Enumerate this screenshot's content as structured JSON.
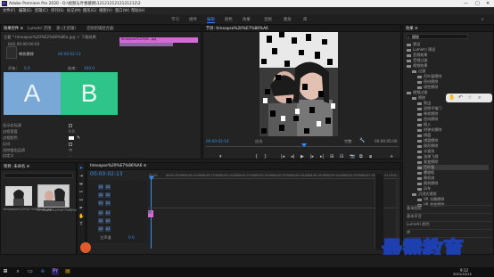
{
  "app": {
    "title": "Adobe Premiere Pro 2020 - D:\\视频与叶春葵网\\1212121212121212\\2",
    "window_controls": [
      "—",
      "□",
      "✕"
    ]
  },
  "menu": [
    "文件(F)",
    "编辑(E)",
    "剪辑(C)",
    "序列(S)",
    "标记(M)",
    "图形(G)",
    "视图(V)",
    "窗口(W)",
    "帮助(H)"
  ],
  "workspaces": [
    {
      "label": "学习",
      "active": false
    },
    {
      "label": "组件",
      "active": false
    },
    {
      "label": "编辑",
      "active": true
    },
    {
      "label": "颜色",
      "active": false
    },
    {
      "label": "效果",
      "active": false
    },
    {
      "label": "音频",
      "active": false
    },
    {
      "label": "图形",
      "active": false
    },
    {
      "label": "库",
      "active": false
    }
  ],
  "effect_controls": {
    "tabs": [
      "效果控件 ≡",
      "Lumetri 范围",
      "源:(无剪辑)",
      "音频剪辑混合器:"
    ],
    "source": "主要 * timeapse%20%E2%80%86a.jpg ＞ 下载效果",
    "sub": "时间 00:00:00:00",
    "fx_name": "带状擦除",
    "letters": [
      "A",
      "B"
    ],
    "start_label": "开始：",
    "start_val": "0.0",
    "end_label": "结束：",
    "end_val": "100.0",
    "rows": [
      {
        "label": "显示实际源",
        "type": "check"
      },
      {
        "label": "边框宽度",
        "type": "value",
        "value": "0.0"
      },
      {
        "label": "边框颜色",
        "type": "color"
      },
      {
        "label": "反向",
        "type": "check"
      },
      {
        "label": "消除锯齿品质",
        "type": "value",
        "value": "中"
      },
      {
        "label": "自定义",
        "type": "text",
        "value": "..."
      }
    ],
    "timecode": "00:00:02:13",
    "clip_label": "timeapse%20%6...jpg"
  },
  "program": {
    "tab": "节目: timeapse%20%E7%86%A6",
    "timecode_left": "00:00:02:14",
    "fit": "适合",
    "quality": "完整",
    "timecode_right": "00:00:05:00"
  },
  "transport": [
    "▾",
    "{",
    "}",
    "|◂",
    "◂|",
    "▶",
    "|▸",
    "▸|",
    "⊞",
    "⊟",
    "📷",
    "⧉",
    "⧈",
    "+"
  ],
  "project": {
    "tab": "项目: 未命名 ≡",
    "items": [
      {
        "name": "timeapse%20%E7%86%A6.jpg",
        "dur": "5:00"
      },
      {
        "name": "timeapse%20%E7%86%A6.jpg",
        "dur": "5:00"
      }
    ]
  },
  "timeline": {
    "tab": "timeapse%20%E7%86%A6 ≡",
    "timecode": "00:00:02:13",
    "ruler": [
      "00:00",
      "00:00:05:00",
      "00:00:10:00",
      "00:00:15:00",
      "00:00:20:00",
      "00:00:25:00",
      "00:00:30:00",
      "00:00:35:00",
      "00:00:40:00",
      "00:00:45:00",
      "00:00:50:00",
      "00:00:55:00",
      "00:01:00:00",
      "00:01:05:00"
    ],
    "tracks": [
      "V3",
      "V2",
      "V1",
      "A1",
      "A2",
      "A3"
    ],
    "master": "主声道",
    "master_val": "0.0"
  },
  "effects": {
    "tab": "效果 ≡",
    "search": "擦除",
    "tree": [
      {
        "label": "预设",
        "level": 0
      },
      {
        "label": "Lumetri 预设",
        "level": 0
      },
      {
        "label": "音频效果",
        "level": 0
      },
      {
        "label": "音频过渡",
        "level": 0
      },
      {
        "label": "视频效果",
        "level": 0
      },
      {
        "label": "过渡",
        "level": 1
      },
      {
        "label": "百叶窗擦除",
        "level": 2
      },
      {
        "label": "径向擦除",
        "level": 2
      },
      {
        "label": "线性擦除",
        "level": 2
      },
      {
        "label": "视频过渡",
        "level": 0
      },
      {
        "label": "擦除",
        "level": 1
      },
      {
        "label": "划出",
        "level": 2
      },
      {
        "label": "双侧平推门",
        "level": 2
      },
      {
        "label": "带状擦除",
        "level": 2
      },
      {
        "label": "径向擦除",
        "level": 2
      },
      {
        "label": "插入",
        "level": 2
      },
      {
        "label": "时钟式擦除",
        "level": 2
      },
      {
        "label": "棋盘",
        "level": 2
      },
      {
        "label": "棋盘擦除",
        "level": 2
      },
      {
        "label": "楔形擦除",
        "level": 2
      },
      {
        "label": "水波块",
        "level": 2
      },
      {
        "label": "油漆飞溅",
        "level": 2
      },
      {
        "label": "渐变擦除",
        "level": 2
      },
      {
        "label": "百叶窗",
        "level": 2
      },
      {
        "label": "螺旋框",
        "level": 2
      },
      {
        "label": "随机块",
        "level": 2
      },
      {
        "label": "随机擦除",
        "level": 2
      },
      {
        "label": "风车",
        "level": 2
      },
      {
        "label": "沉浸式视频",
        "level": 1
      },
      {
        "label": "VR 光圈擦除",
        "level": 2
      },
      {
        "label": "VR 渐变擦除",
        "level": 2
      }
    ],
    "extra": [
      "基本图形",
      "基本声音",
      "Lumetri 颜色",
      "库",
      "标记"
    ]
  },
  "watermark": "最需教育",
  "taskbar": {
    "time": "9:12",
    "date": "2021/10/13"
  }
}
